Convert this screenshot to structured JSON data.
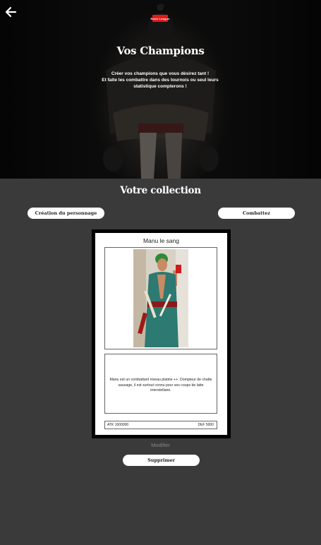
{
  "header": {
    "logo_text": "Rock League",
    "title": "Vos Champions",
    "subtitle_lines": [
      "Créer vos champions que vous désirez tant !",
      "Et faite les combattre dans des tournois ou seul leurs",
      "statistique compterons !"
    ]
  },
  "collection": {
    "title": "Votre collection",
    "create_button": "Création du personnage",
    "fight_button": "Combattez"
  },
  "card": {
    "name": "Manu le sang",
    "description": "Manu est un combattant niveau platine ++. Dompteur de chatte sauvage, il est surtout connu pour ses coups de latte interstellaire.",
    "atk": "ATK 1000000",
    "def": "DEF 5000",
    "modify_label": "Modifier",
    "delete_label": "Supprimer"
  },
  "colors": {
    "background": "#3a3a3a",
    "card_border": "#000000",
    "logo_red": "#e01a1a"
  }
}
